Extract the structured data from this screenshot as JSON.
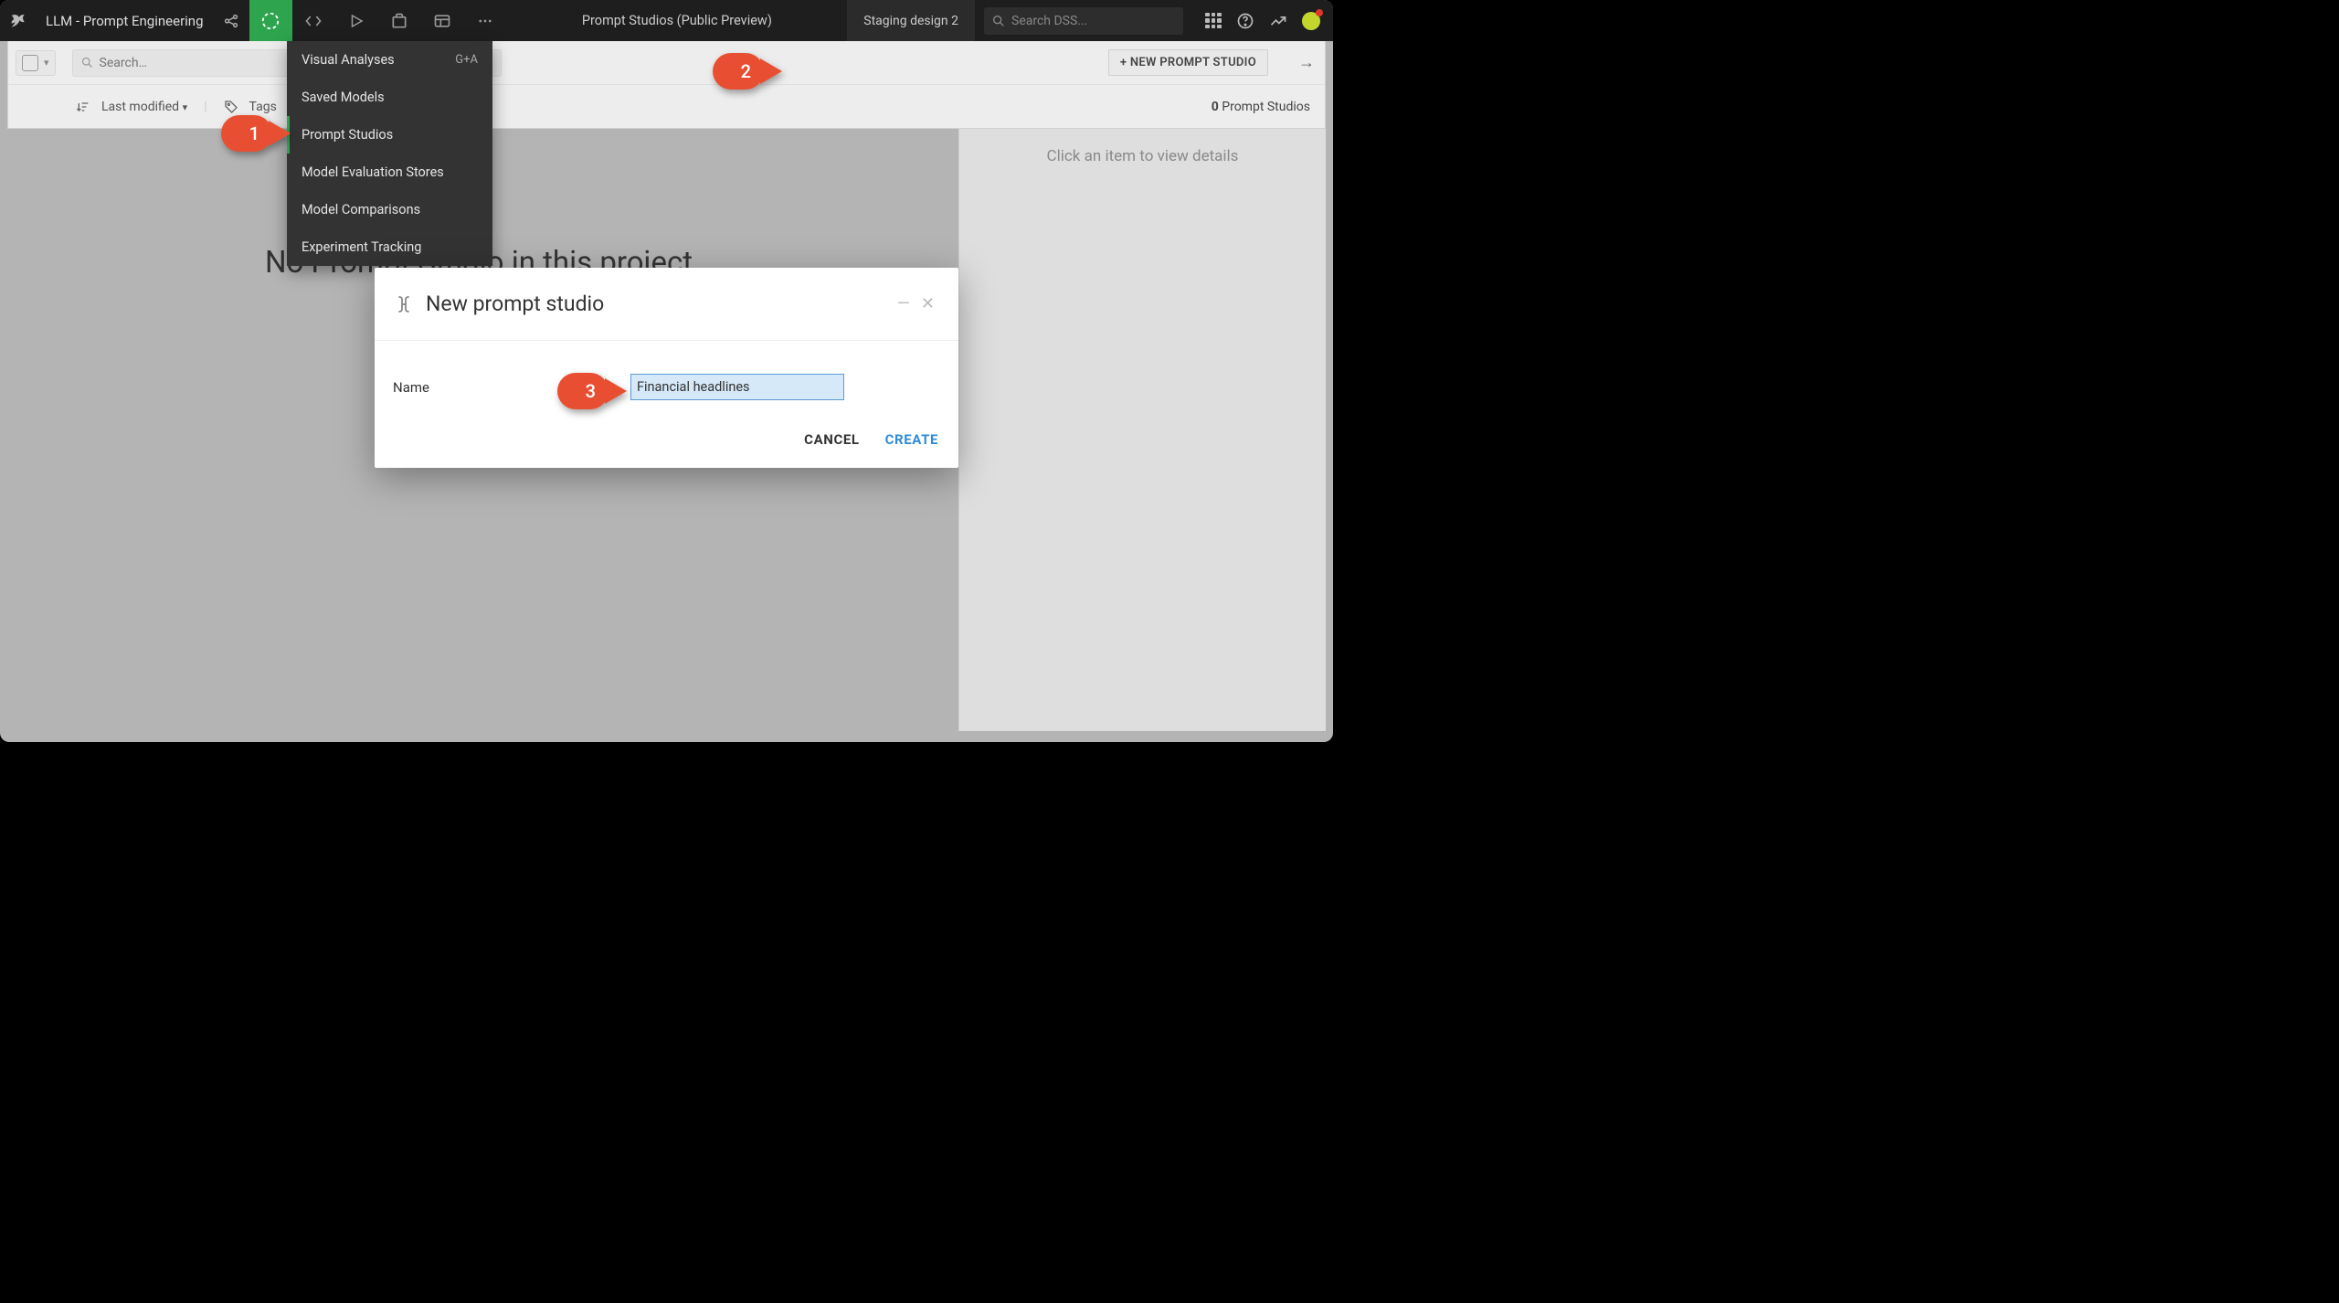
{
  "topbar": {
    "project_title": "LLM - Prompt Engineering",
    "breadcrumb_center": "Prompt Studios (Public Preview)",
    "right_tab": "Staging design 2",
    "search_placeholder": "Search DSS..."
  },
  "subbar": {
    "search_placeholder": "Search…",
    "new_button": "+ NEW PROMPT STUDIO",
    "sort_label": "Last modified",
    "tags_label": "Tags",
    "count_value": "0",
    "count_label": "Prompt Studios"
  },
  "dropdown": {
    "items": [
      {
        "label": "Visual Analyses",
        "shortcut": "G+A",
        "active": false
      },
      {
        "label": "Saved Models",
        "shortcut": "",
        "active": false
      },
      {
        "label": "Prompt Studios",
        "shortcut": "",
        "active": true
      },
      {
        "label": "Model Evaluation Stores",
        "shortcut": "",
        "active": false
      },
      {
        "label": "Model Comparisons",
        "shortcut": "",
        "active": false
      },
      {
        "label": "Experiment Tracking",
        "shortcut": "",
        "active": false
      }
    ]
  },
  "main": {
    "heading": "No Prompt Studio in this project",
    "line1": "Prompt Studio",
    "line2": "Prompt Stu"
  },
  "right_panel": {
    "placeholder": "Click an item to view details"
  },
  "modal": {
    "title": "New prompt studio",
    "field_label": "Name",
    "field_value": "Financial headlines",
    "cancel": "CANCEL",
    "create": "CREATE"
  },
  "callouts": {
    "c1": "1",
    "c2": "2",
    "c3": "3"
  }
}
